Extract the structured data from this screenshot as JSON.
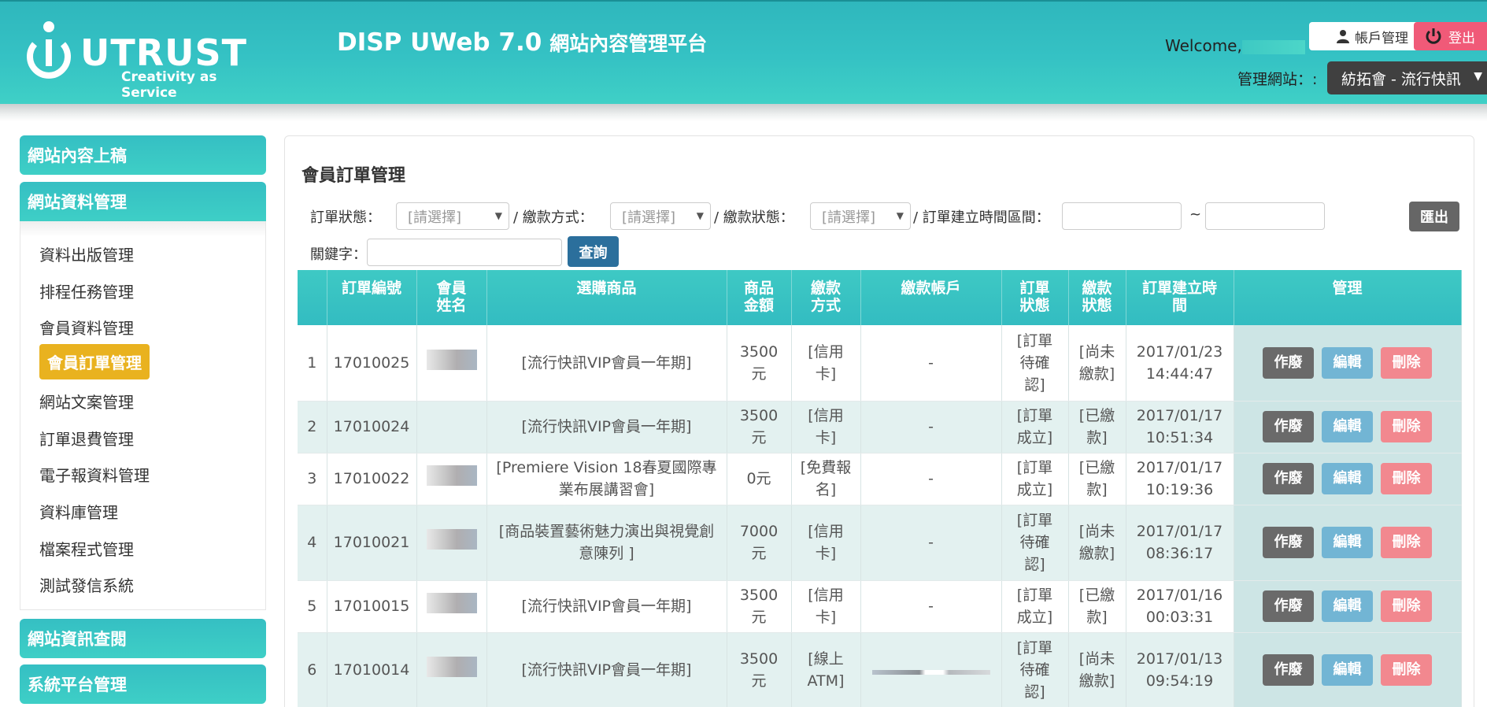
{
  "header": {
    "logo_main": "UTRUST",
    "logo_tagline": "Creativity as Service",
    "app_name": "DISP UWeb 7.0",
    "app_subtitle": "網站內容管理平台",
    "welcome": "Welcome,",
    "account_button": "帳戶管理",
    "logout_button": "登出",
    "site_label": "管理網站：:",
    "site_selected": "紡拓會 - 流行快訊"
  },
  "sidebar": {
    "sections": [
      {
        "label": "網站內容上稿"
      },
      {
        "label": "網站資料管理"
      },
      {
        "label": "網站資訊查閱"
      },
      {
        "label": "系統平台管理"
      }
    ],
    "items": [
      {
        "label": "資料出版管理"
      },
      {
        "label": "排程任務管理"
      },
      {
        "label": "會員資料管理"
      },
      {
        "label": "會員訂單管理"
      },
      {
        "label": "網站文案管理"
      },
      {
        "label": "訂單退費管理"
      },
      {
        "label": "電子報資料管理"
      },
      {
        "label": "資料庫管理"
      },
      {
        "label": "檔案程式管理"
      },
      {
        "label": "測試發信系統"
      }
    ]
  },
  "main": {
    "title": "會員訂單管理",
    "filters": {
      "order_status_label": "訂單狀態：",
      "payment_method_label": "/ 繳款方式：",
      "payment_status_label": "/ 繳款狀態：",
      "created_range_label": "/ 訂單建立時間區間：",
      "range_sep": "~",
      "keyword_label": "關鍵字：",
      "select_placeholder": "[請選擇]",
      "export_button": "匯出",
      "search_button": "查詢"
    },
    "table": {
      "headers": [
        "",
        "訂單編號",
        "會員\n姓名",
        "選購商品",
        "商品\n金額",
        "繳款\n方式",
        "繳款帳戶",
        "訂單\n狀態",
        "繳款\n狀態",
        "訂單建立時\n間",
        "管理"
      ],
      "rows": [
        {
          "no": "1",
          "order_id": "17010025",
          "product": "[流行快訊VIP會員一年期]",
          "amount": "3500\n元",
          "method": "[信用\n卡]",
          "account": "-",
          "order_status": "[訂單\n待確\n認]",
          "pay_status": "[尚未\n繳款]",
          "pay_red": true,
          "created": "2017/01/23\n14:44:47"
        },
        {
          "no": "2",
          "order_id": "17010024",
          "product": "[流行快訊VIP會員一年期]",
          "amount": "3500\n元",
          "method": "[信用\n卡]",
          "account": "-",
          "order_status": "[訂單\n成立]",
          "pay_status": "[已繳\n款]",
          "pay_red": false,
          "created": "2017/01/17\n10:51:34"
        },
        {
          "no": "3",
          "order_id": "17010022",
          "product": "[Premiere Vision 18春夏國際專\n業布展講習會]",
          "amount": "0元",
          "method": "[免費報\n名]",
          "account": "-",
          "order_status": "[訂單\n成立]",
          "pay_status": "[已繳\n款]",
          "pay_red": false,
          "created": "2017/01/17\n10:19:36"
        },
        {
          "no": "4",
          "order_id": "17010021",
          "product": "[商品裝置藝術魅力演出與視覺創\n意陳列 ]",
          "amount": "7000\n元",
          "method": "[信用\n卡]",
          "account": "-",
          "order_status": "[訂單\n待確\n認]",
          "pay_status": "[尚未\n繳款]",
          "pay_red": true,
          "created": "2017/01/17\n08:36:17"
        },
        {
          "no": "5",
          "order_id": "17010015",
          "product": "[流行快訊VIP會員一年期]",
          "amount": "3500\n元",
          "method": "[信用\n卡]",
          "account": "-",
          "order_status": "[訂單\n成立]",
          "pay_status": "[已繳\n款]",
          "pay_red": false,
          "created": "2017/01/16\n00:03:31"
        },
        {
          "no": "6",
          "order_id": "17010014",
          "product": "[流行快訊VIP會員一年期]",
          "amount": "3500\n元",
          "method": "[線上\nATM]",
          "account": "",
          "order_status": "[訂單\n待確\n認]",
          "pay_status": "[尚未\n繳款]",
          "pay_red": true,
          "created": "2017/01/13\n09:54:19"
        }
      ],
      "actions": {
        "void": "作廢",
        "edit": "編輯",
        "delete": "刪除"
      }
    }
  }
}
